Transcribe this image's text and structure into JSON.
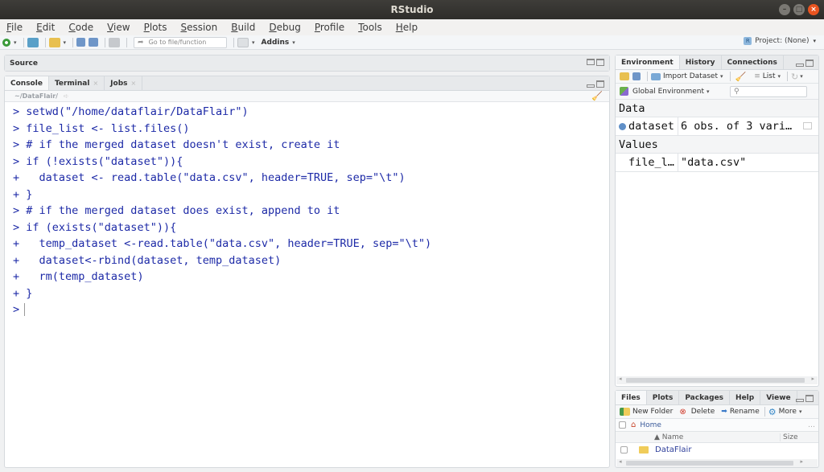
{
  "window": {
    "title": "RStudio"
  },
  "menubar": [
    {
      "label": "File",
      "mnemonic": "F",
      "rest": "ile"
    },
    {
      "label": "Edit",
      "mnemonic": "E",
      "rest": "dit"
    },
    {
      "label": "Code",
      "mnemonic": "C",
      "rest": "ode"
    },
    {
      "label": "View",
      "mnemonic": "V",
      "rest": "iew"
    },
    {
      "label": "Plots",
      "mnemonic": "P",
      "rest": "lots"
    },
    {
      "label": "Session",
      "mnemonic": "S",
      "rest": "ession"
    },
    {
      "label": "Build",
      "mnemonic": "B",
      "rest": "uild"
    },
    {
      "label": "Debug",
      "mnemonic": "D",
      "rest": "ebug"
    },
    {
      "label": "Profile",
      "mnemonic": "P",
      "rest": "rofile"
    },
    {
      "label": "Tools",
      "mnemonic": "T",
      "rest": "ools"
    },
    {
      "label": "Help",
      "mnemonic": "H",
      "rest": "elp"
    }
  ],
  "toolbar": {
    "goto_placeholder": "Go to file/function",
    "addins_label": "Addins",
    "project_label": "Project: (None)"
  },
  "source_pane": {
    "title": "Source"
  },
  "console_pane": {
    "tabs": [
      {
        "label": "Console",
        "closable": false
      },
      {
        "label": "Terminal",
        "closable": true
      },
      {
        "label": "Jobs",
        "closable": true
      }
    ],
    "working_dir": "~/DataFlair/",
    "lines": [
      {
        "prompt": ">",
        "code": " setwd(\"/home/dataflair/DataFlair\")"
      },
      {
        "prompt": ">",
        "code": " file_list <- list.files()"
      },
      {
        "prompt": ">",
        "code": " # if the merged dataset doesn't exist, create it"
      },
      {
        "prompt": ">",
        "code": " if (!exists(\"dataset\")){"
      },
      {
        "prompt": "+",
        "code": "   dataset <- read.table(\"data.csv\", header=TRUE, sep=\"\\t\")"
      },
      {
        "prompt": "+",
        "code": " }"
      },
      {
        "prompt": ">",
        "code": " # if the merged dataset does exist, append to it"
      },
      {
        "prompt": ">",
        "code": " if (exists(\"dataset\")){"
      },
      {
        "prompt": "+",
        "code": "   temp_dataset <-read.table(\"data.csv\", header=TRUE, sep=\"\\t\")"
      },
      {
        "prompt": "+",
        "code": "   dataset<-rbind(dataset, temp_dataset)"
      },
      {
        "prompt": "+",
        "code": "   rm(temp_dataset)"
      },
      {
        "prompt": "+",
        "code": " }"
      }
    ],
    "current_prompt": ">"
  },
  "env_pane": {
    "tabs": [
      "Environment",
      "History",
      "Connections"
    ],
    "import_label": "Import Dataset",
    "list_label": "List",
    "scope_label": "Global Environment",
    "sections": {
      "data": {
        "title": "Data",
        "rows": [
          {
            "name": "dataset",
            "value": "6 obs. of 3 vari…"
          }
        ]
      },
      "values": {
        "title": "Values",
        "rows": [
          {
            "name": "file_l…",
            "value": "\"data.csv\""
          }
        ]
      }
    }
  },
  "files_pane": {
    "tabs": [
      "Files",
      "Plots",
      "Packages",
      "Help",
      "Viewe"
    ],
    "actions": {
      "new_folder": "New Folder",
      "delete": "Delete",
      "rename": "Rename",
      "more": "More"
    },
    "path": "Home",
    "columns": {
      "name": "▲ Name",
      "size": "Size"
    },
    "files": [
      {
        "name": "DataFlair",
        "type": "folder",
        "size": ""
      }
    ]
  }
}
